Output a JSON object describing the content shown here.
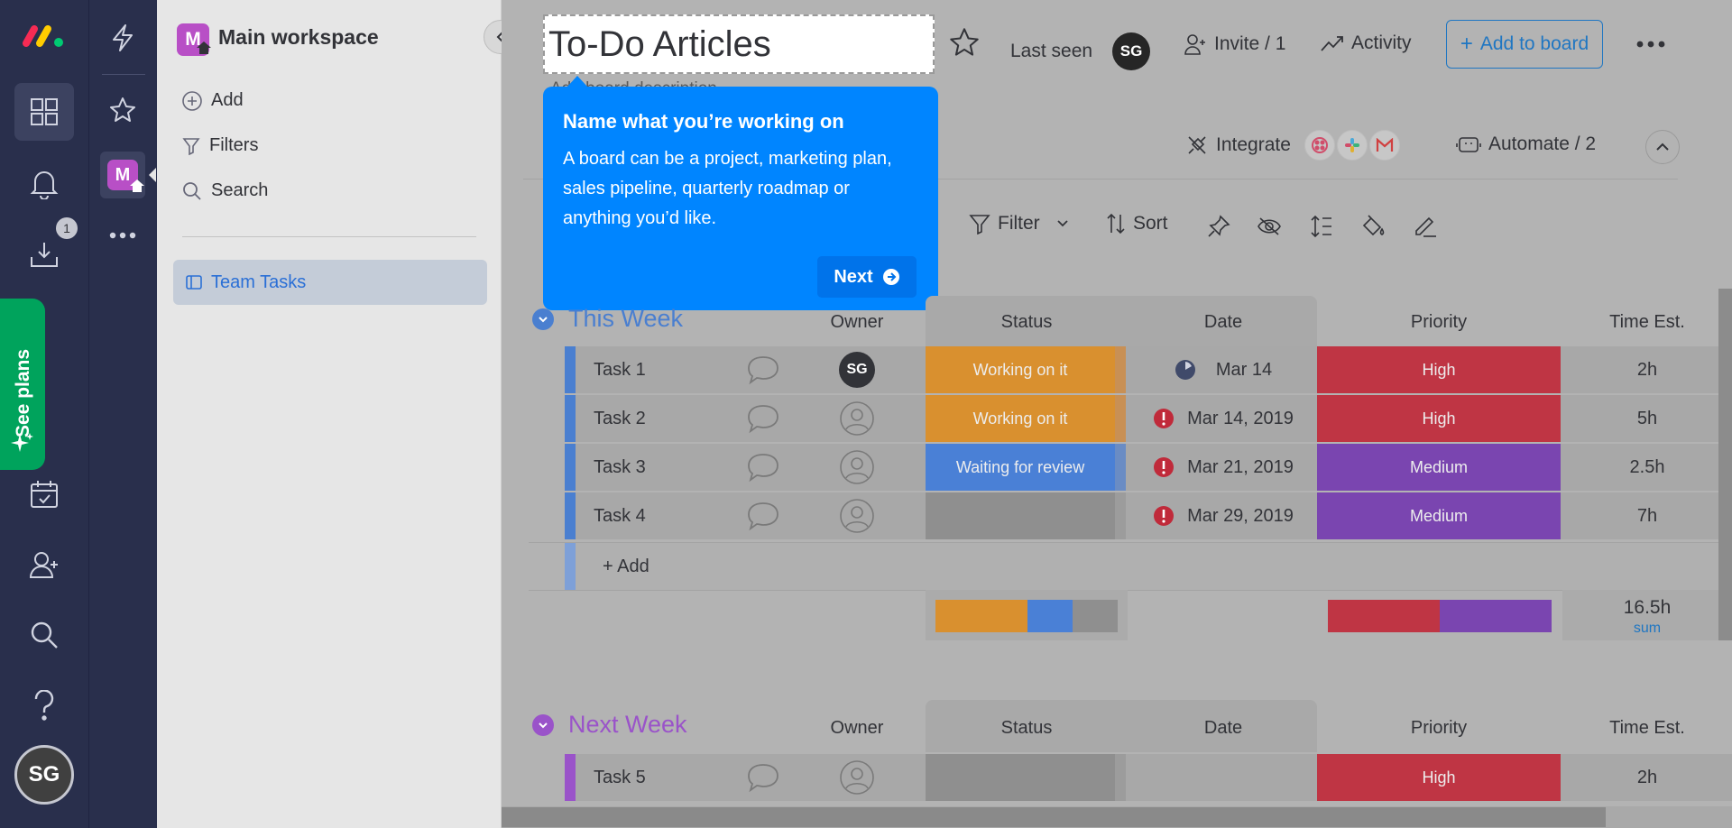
{
  "app": {
    "colors": {
      "rail": "#292f4c",
      "accent": "#0073ea",
      "tooltip": "#0085ff",
      "see_plans": "#00a35c"
    },
    "rail": {
      "items": [
        {
          "icon": "workspace-grid-icon"
        },
        {
          "icon": "bell-icon"
        },
        {
          "icon": "inbox-download-icon",
          "badge": "1"
        },
        {
          "icon": "calendar-check-icon"
        },
        {
          "icon": "add-person-icon"
        },
        {
          "icon": "search-icon"
        },
        {
          "icon": "help-icon"
        }
      ],
      "see_plans": "See plans",
      "avatar": "SG"
    },
    "rail2": {
      "workspace_avatar": "M"
    }
  },
  "workspace": {
    "name": "Main workspace",
    "avatar": "M",
    "menu": {
      "add": "Add",
      "filters": "Filters",
      "search": "Search"
    },
    "boards": [
      {
        "label": "Team Tasks"
      }
    ]
  },
  "header": {
    "title": "To-Do Articles",
    "last_seen_label": "Last seen",
    "last_seen_avatar": "SG",
    "invite": "Invite / 1",
    "activity": "Activity",
    "add_to_board": "Add to board",
    "description_partial": "Add board description"
  },
  "toolbar": {
    "integrate": "Integrate",
    "automate": "Automate / 2",
    "filter": "Filter",
    "sort": "Sort"
  },
  "tooltip": {
    "title": "Name what you’re working on",
    "body": "A board can be a project, marketing plan, sales pipeline, quarterly roadmap or anything you’d like.",
    "next": "Next"
  },
  "columns": {
    "owner": "Owner",
    "status": "Status",
    "date": "Date",
    "priority": "Priority",
    "time_est": "Time Est."
  },
  "groups": [
    {
      "title": "This Week",
      "color": "#4a7fd0",
      "rows": [
        {
          "name": "Task 1",
          "owner": "SG",
          "status": "Working on it",
          "status_color": "#d9902f",
          "date": "Mar 14",
          "date_flag": "clock",
          "priority": "High",
          "priority_color": "#bf3544",
          "time": "2h"
        },
        {
          "name": "Task 2",
          "owner": "",
          "status": "Working on it",
          "status_color": "#d9902f",
          "date": "Mar 14, 2019",
          "date_flag": "alert",
          "priority": "High",
          "priority_color": "#bf3544",
          "time": "5h"
        },
        {
          "name": "Task 3",
          "owner": "",
          "status": "Waiting for review",
          "status_color": "#4a80d6",
          "date": "Mar 21, 2019",
          "date_flag": "alert",
          "priority": "Medium",
          "priority_color": "#7a45b0",
          "time": "2.5h"
        },
        {
          "name": "Task 4",
          "owner": "",
          "status": "",
          "status_color": "#8f8f8f",
          "date": "Mar 29, 2019",
          "date_flag": "alert",
          "priority": "Medium",
          "priority_color": "#7a45b0",
          "time": "7h"
        }
      ],
      "add_label": "+ Add",
      "summary": {
        "time_total": "16.5h",
        "time_fn": "sum"
      }
    },
    {
      "title": "Next Week",
      "color": "#9a53c9",
      "rows": [
        {
          "name": "Task 5",
          "owner": "",
          "status": "",
          "status_color": "#8f8f8f",
          "date": "",
          "priority": "High",
          "priority_color": "#bf3544",
          "time": "2h"
        }
      ]
    }
  ]
}
